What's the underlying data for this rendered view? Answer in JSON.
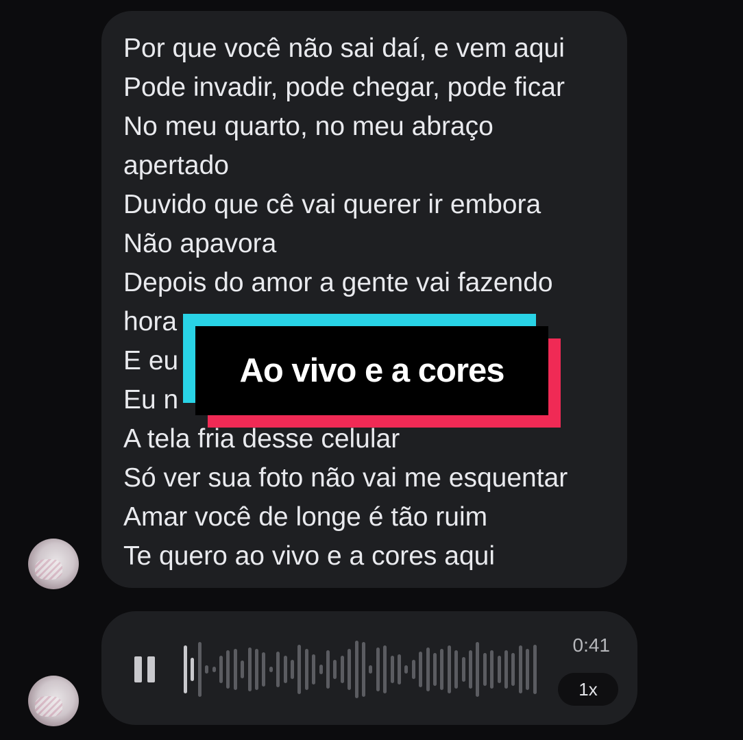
{
  "message": {
    "lines": [
      "Por que você não sai daí, e vem aqui",
      "Pode invadir, pode chegar, pode ficar",
      "No meu quarto, no meu abraço",
      "apertado",
      "Duvido que cê vai querer ir embora",
      "Não apavora",
      "Depois do amor a gente vai fazendo",
      "hora",
      "E eu",
      "Eu n",
      "A tela fria desse celular",
      "Só ver sua foto não vai me esquentar",
      "Amar você de longe é tão ruim",
      "Te quero ao vivo e a cores aqui"
    ]
  },
  "caption": {
    "text": "Ao vivo e a cores",
    "colors": {
      "cyan": "#29d3e6",
      "pink": "#f02a55",
      "box": "#000000"
    }
  },
  "audio": {
    "duration": "0:41",
    "speed": "1x",
    "state": "playing",
    "progress": 0.04,
    "icons": {
      "control": "pause-icon"
    }
  },
  "colors": {
    "background": "#0c0c0e",
    "bubble": "#1e1f22",
    "text": "#e9eaee",
    "wave_played": "#c9c9cd",
    "wave_unplayed": "#5b5c61"
  }
}
